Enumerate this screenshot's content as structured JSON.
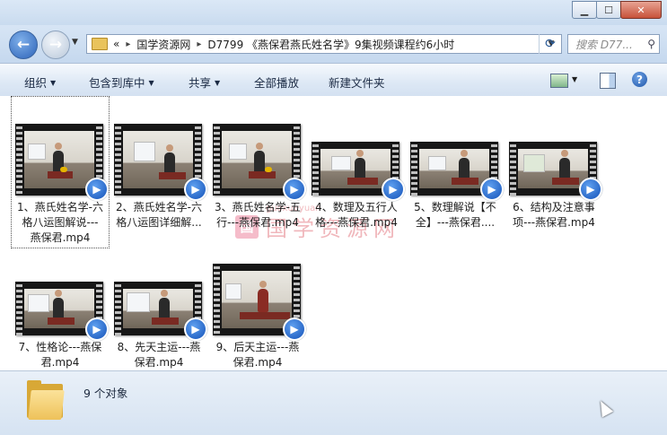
{
  "window": {
    "minimize_icon": "minimize-icon",
    "maximize_icon": "maximize-icon",
    "close_icon": "close-icon"
  },
  "nav": {
    "back_glyph": "←",
    "forward_glyph": "→",
    "recent_glyph": "▼"
  },
  "address": {
    "prefix": "«",
    "crumbs": [
      "国学资源网",
      "D7799 《燕保君燕氏姓名学》9集视频课程约6小时"
    ],
    "separator": "▸"
  },
  "search": {
    "placeholder": "搜索 D77...",
    "icon": "search-icon"
  },
  "toolbar": {
    "organize": "组织",
    "include_library": "包含到库中",
    "share": "共享",
    "play_all": "全部播放",
    "new_folder": "新建文件夹",
    "help": "?"
  },
  "watermark": {
    "seal": "国",
    "text": "国学资源网",
    "sub": "guoxueyuan"
  },
  "files": [
    {
      "line1": "1、燕氏姓名学-六",
      "line2": "格八运图解说---",
      "line3": "燕保君.mp4"
    },
    {
      "line1": "2、燕氏姓名学-六",
      "line2": "格八运图详细解...",
      "line3": ""
    },
    {
      "line1": "3、燕氏姓名学-五",
      "line2": "行---燕保君.mp4",
      "line3": ""
    },
    {
      "line1": "4、数理及五行人",
      "line2": "格---燕保君.mp4",
      "line3": ""
    },
    {
      "line1": "5、数理解说【不",
      "line2": "全】---燕保君....",
      "line3": ""
    },
    {
      "line1": "6、结构及注意事",
      "line2": "项---燕保君.mp4",
      "line3": ""
    },
    {
      "line1": "7、性格论---燕保",
      "line2": "君.mp4",
      "line3": ""
    },
    {
      "line1": "8、先天主运---燕",
      "line2": "保君.mp4",
      "line3": ""
    },
    {
      "line1": "9、后天主运---燕",
      "line2": "保君.mp4",
      "line3": ""
    }
  ],
  "status": {
    "count": "9 个对象"
  }
}
